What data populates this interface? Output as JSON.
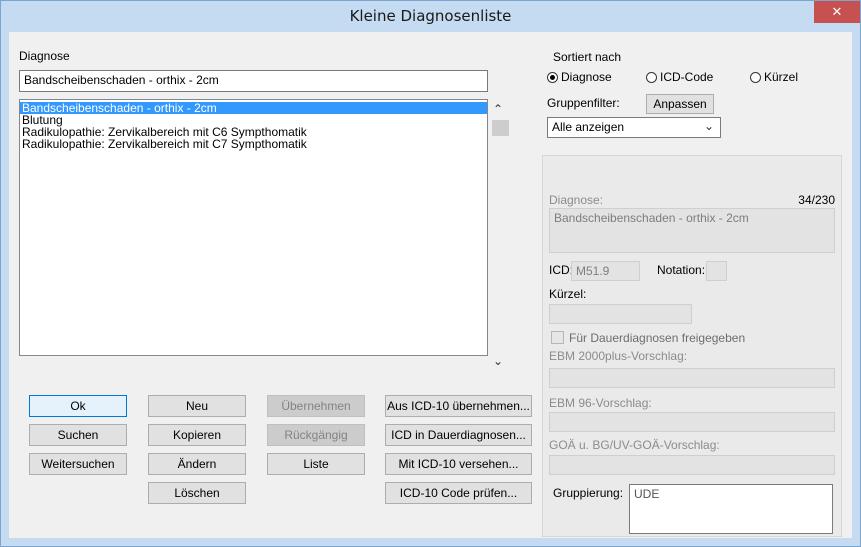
{
  "window": {
    "title": "Kleine Diagnosenliste",
    "close_glyph": "✕"
  },
  "left": {
    "diagnose_label": "Diagnose",
    "diagnose_value": "Bandscheibenschaden - orthix - 2cm",
    "list_items": [
      "Bandscheibenschaden - orthix - 2cm",
      "Blutung",
      "Radikulopathie: Zervikalbereich mit C6 Sympthomatik",
      "Radikulopathie: Zervikalbereich mit C7 Sympthomatik"
    ],
    "scroll_up": "⌃",
    "scroll_down": "⌄"
  },
  "buttons": {
    "ok": "Ok",
    "suchen": "Suchen",
    "weitersuchen": "Weitersuchen",
    "neu": "Neu",
    "kopieren": "Kopieren",
    "aendern": "Ändern",
    "loeschen": "Löschen",
    "uebernehmen": "Übernehmen",
    "rueckgaengig": "Rückgängig",
    "liste": "Liste",
    "aus_icd": "Aus ICD-10 übernehmen...",
    "icd_dauer": "ICD in Dauerdiagnosen...",
    "mit_icd": "Mit ICD-10 versehen...",
    "icd_pruefen": "ICD-10 Code prüfen..."
  },
  "sort": {
    "title": "Sortiert nach",
    "options": [
      "Diagnose",
      "ICD-Code",
      "Kürzel"
    ],
    "selected": 0,
    "gruppenfilter_label": "Gruppenfilter:",
    "anpassen": "Anpassen",
    "filter_value": "Alle anzeigen",
    "dropdown_glyph": "⌄"
  },
  "detail": {
    "diagnose_label": "Diagnose:",
    "count": "34/230",
    "diagnose_text": "Bandscheibenschaden - orthix - 2cm",
    "icd_label": "ICD:",
    "icd_value": "M51.9",
    "notation_label": "Notation:",
    "notation_value": "",
    "kuerzel_label": "Kürzel:",
    "kuerzel_value": "",
    "dauer_label": "Für Dauerdiagnosen freigegeben",
    "ebm2000_label": "EBM 2000plus-Vorschlag:",
    "ebm2000_value": "",
    "ebm96_label": "EBM 96-Vorschlag:",
    "ebm96_value": "",
    "goa_label": "GOÄ u. BG/UV-GOÄ-Vorschlag:",
    "goa_value": "",
    "gruppierung_label": "Gruppierung:",
    "gruppierung_value": "UDE"
  }
}
